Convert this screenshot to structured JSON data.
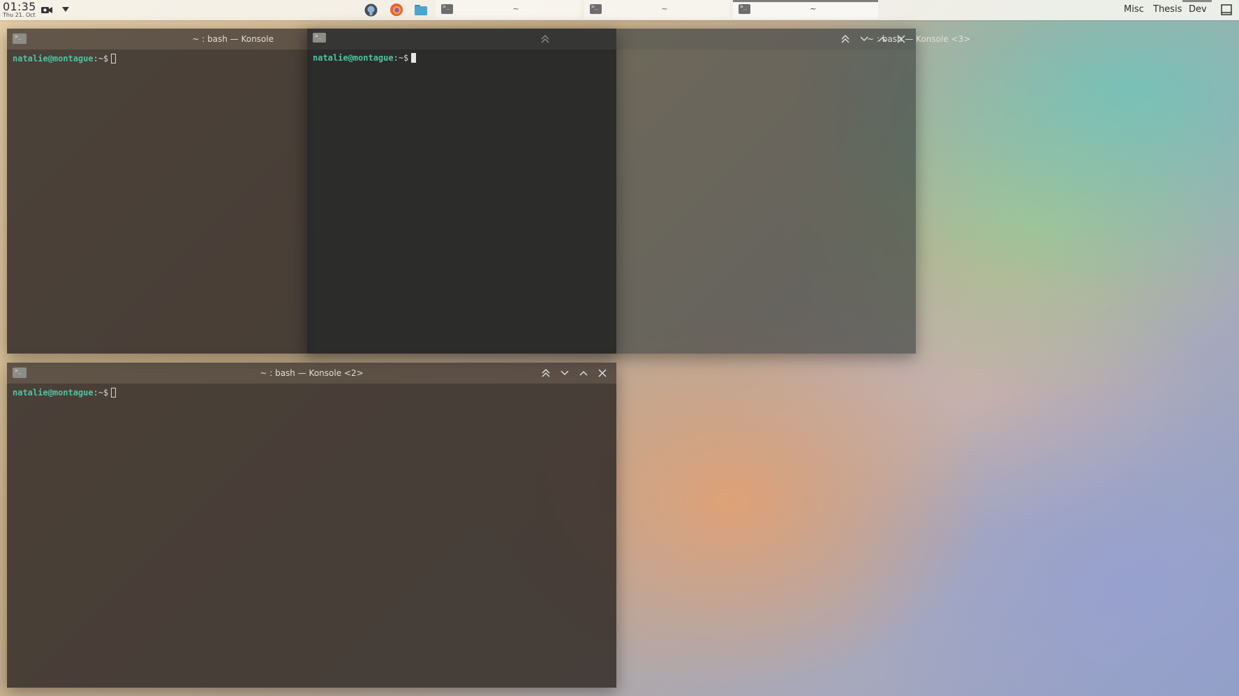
{
  "panel": {
    "clock": {
      "time": "01:35",
      "date": "Thu 21. Oct"
    },
    "tasks": [
      {
        "label": "~",
        "active": false
      },
      {
        "label": "~",
        "active": false
      },
      {
        "label": "~",
        "active": true
      }
    ],
    "activities": [
      "Misc",
      "Thesis",
      "Dev"
    ],
    "current_activity": "Dev"
  },
  "windows": {
    "konsole1": {
      "title": "~ : bash — Konsole",
      "prompt_user": "natalie@montague",
      "prompt_path": ":~$"
    },
    "konsole_mid": {
      "prompt_user": "natalie@montague",
      "prompt_path": ":~$"
    },
    "konsole3": {
      "title": "~ : bash — Konsole <3>"
    },
    "konsole2": {
      "title": "~ : bash — Konsole <2>",
      "prompt_user": "natalie@montague",
      "prompt_path": ":~$"
    }
  },
  "colors": {
    "prompt_user": "#4fc3a1",
    "titlebar": "#463c36",
    "terminal_bg": "#3a322e"
  }
}
